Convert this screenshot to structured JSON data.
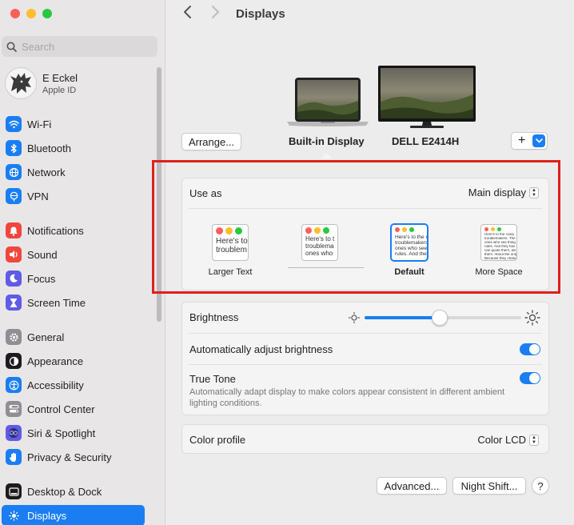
{
  "window": {
    "title": "Displays"
  },
  "sidebar": {
    "search_placeholder": "Search",
    "account": {
      "name": "E Eckel",
      "subtitle": "Apple ID"
    },
    "items": [
      {
        "label": "Wi-Fi",
        "icon": "wifi-icon",
        "color": "#1a7ef2"
      },
      {
        "label": "Bluetooth",
        "icon": "bluetooth-icon",
        "color": "#1a7ef2"
      },
      {
        "label": "Network",
        "icon": "globe-icon",
        "color": "#1a7ef2"
      },
      {
        "label": "VPN",
        "icon": "vpn-globe-icon",
        "color": "#1a7ef2"
      },
      {
        "label": "Notifications",
        "icon": "bell-icon",
        "color": "#f0463c"
      },
      {
        "label": "Sound",
        "icon": "speaker-icon",
        "color": "#f0463c"
      },
      {
        "label": "Focus",
        "icon": "moon-icon",
        "color": "#5e5ce6"
      },
      {
        "label": "Screen Time",
        "icon": "hourglass-icon",
        "color": "#5e5ce6"
      },
      {
        "label": "General",
        "icon": "gear-icon",
        "color": "#8e8e93"
      },
      {
        "label": "Appearance",
        "icon": "appearance-icon",
        "color": "#1c1c1e"
      },
      {
        "label": "Accessibility",
        "icon": "accessibility-icon",
        "color": "#1a7ef2"
      },
      {
        "label": "Control Center",
        "icon": "control-center-icon",
        "color": "#8e8e93"
      },
      {
        "label": "Siri & Spotlight",
        "icon": "siri-icon",
        "color": "#5e5ce6"
      },
      {
        "label": "Privacy & Security",
        "icon": "hand-icon",
        "color": "#1a7ef2"
      },
      {
        "label": "Desktop & Dock",
        "icon": "dock-icon",
        "color": "#1c1c1e"
      },
      {
        "label": "Displays",
        "icon": "sun-display-icon",
        "color": "#1a7ef2"
      }
    ]
  },
  "main": {
    "title": "Displays",
    "arrange_label": "Arrange...",
    "add_label": "+",
    "displays": [
      "Built-in Display",
      "DELL E2414H"
    ],
    "use_as": {
      "label": "Use as",
      "value": "Main display"
    },
    "resolutions": [
      {
        "label": "Larger Text",
        "preview": [
          "Here's to",
          "troublem"
        ]
      },
      {
        "label": "",
        "preview": [
          "Here's to t",
          "troublema",
          "ones who"
        ]
      },
      {
        "label": "Default",
        "preview": [
          "Here's to the cr",
          "troublemakers.",
          "ones who see t",
          "rules. And they"
        ]
      },
      {
        "label": "More Space",
        "preview": [
          "Here's to the crazy",
          "troublemakers. The",
          "ones who see thing",
          "rules. And they hav",
          "can quote them, dis",
          "them. About the only",
          "Because they chang"
        ]
      }
    ],
    "brightness": {
      "label": "Brightness",
      "value": 0.46
    },
    "auto_brightness": {
      "label": "Automatically adjust brightness",
      "on": true
    },
    "true_tone": {
      "label": "True Tone",
      "description": "Automatically adapt display to make colors appear consistent in different ambient lighting conditions.",
      "on": true
    },
    "color_profile": {
      "label": "Color profile",
      "value": "Color LCD"
    },
    "advanced_label": "Advanced...",
    "night_shift_label": "Night Shift...",
    "help_label": "?"
  },
  "colors": {
    "accent": "#1a7ef2",
    "highlight": "#e0201b"
  }
}
